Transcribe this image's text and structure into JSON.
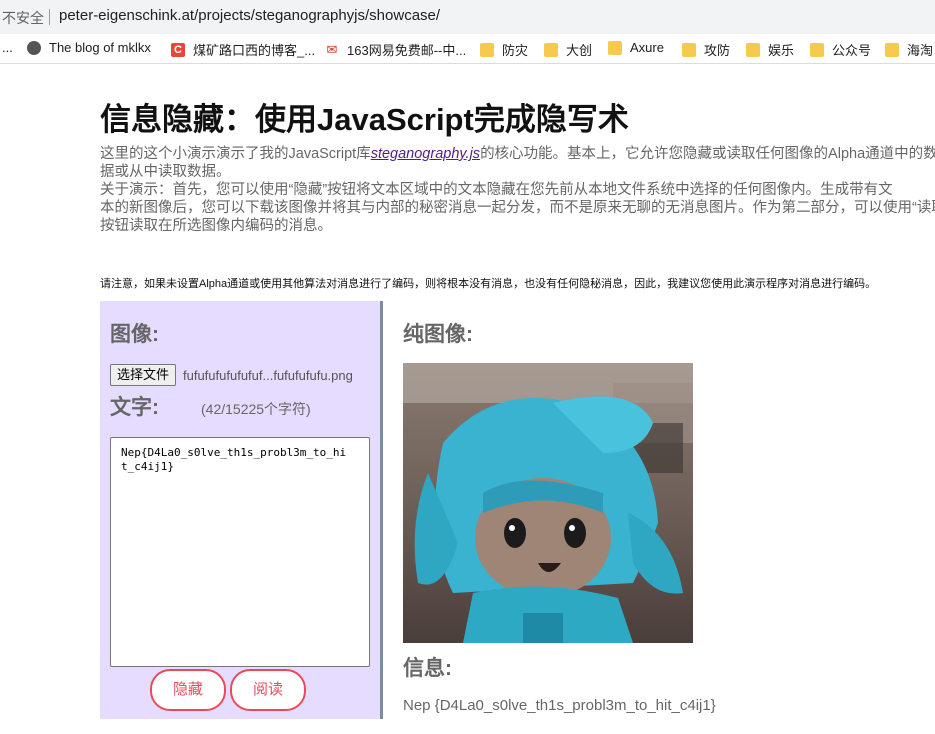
{
  "browser": {
    "insecure_label": "不安全",
    "url": "peter-eigenschink.at/projects/steganographyjs/showcase/",
    "bookmarks": [
      {
        "label": "The blog of mklkx",
        "icon": "globe-icon"
      },
      {
        "label": "煤矿路口西的博客_...",
        "icon": "csdn-icon"
      },
      {
        "label": "163网易免费邮--中...",
        "icon": "mail-icon"
      },
      {
        "label": "防灾",
        "icon": "folder-icon"
      },
      {
        "label": "大创",
        "icon": "folder-icon"
      },
      {
        "label": "Axure",
        "icon": "folder-icon"
      },
      {
        "label": "攻防",
        "icon": "folder-icon"
      },
      {
        "label": "娱乐",
        "icon": "folder-icon"
      },
      {
        "label": "公众号",
        "icon": "folder-icon"
      },
      {
        "label": "海淘",
        "icon": "folder-icon"
      }
    ],
    "overflow_label": "..."
  },
  "page": {
    "title": "信息隐藏：使用JavaScript完成隐写术",
    "desc_line1_pre": "这里的这个小演示演示了我的JavaScript库",
    "desc_link": "steganography.js",
    "desc_line1_post": "的核心功能。基本上，它允许您隐藏或读取任何图像的Alpha通道中的数",
    "desc_line2": "据或从中读取数据。",
    "desc_line3": "关于演示：首先，您可以使用“隐藏”按钮将文本区域中的文本隐藏在您先前从本地文件系统中选择的任何图像内。生成带有文",
    "desc_line4": "本的新图像后，您可以下载该图像并将其与内部的秘密消息一起分发，而不是原来无聊的无消息图片。作为第二部分，可以使用“读取”",
    "desc_line5": "按钮读取在所选图像内编码的消息。",
    "note": "请注意，如果未设置Alpha通道或使用其他算法对消息进行了编码，则将根本没有消息，也没有任何隐秘消息，因此，我建议您使用此演示程序对消息进行编码。"
  },
  "left": {
    "image_heading": "图像:",
    "choose_file_label": "选择文件",
    "file_name": "fufufufufufufuf...fufufufufu.png",
    "text_heading": "文字:",
    "char_count": "(42/15225个字符)",
    "textarea_value": "Nep{D4La0_s0lve_th1s_probl3m_to_hit_c4ij1}",
    "hide_button": "隐藏",
    "read_button": "阅读"
  },
  "right": {
    "plain_image_heading": "纯图像:",
    "image_alt": "plush figure photo",
    "message_heading": "信息:",
    "message_value": "Nep {D4La0_s0lve_th1s_probl3m_to_hit_c4ij1}"
  },
  "colors": {
    "left_panel_bg": "#e5dcff",
    "accent_button": "#e94a5b",
    "link": "#551a8b"
  }
}
